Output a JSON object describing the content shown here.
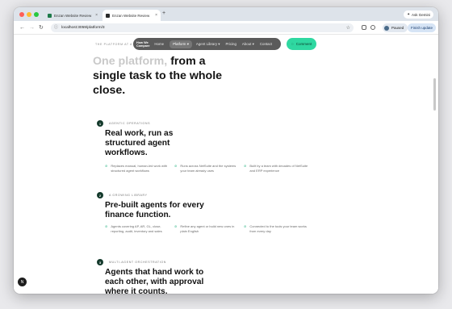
{
  "browser": {
    "tabs": [
      {
        "label": "Enzan Website Review",
        "favicon_color": "#1e7a4a"
      },
      {
        "label": "Enzan Website Review",
        "favicon_color": "#2a2a2a"
      }
    ],
    "new_tab": "+",
    "ask_gemini": "Ask Gemini",
    "url": "localhost:3059/platform/3",
    "profile_label": "Paused",
    "finish_update": "Finish update"
  },
  "site": {
    "eyebrow": "THE PLATFORM AT A GLANCE",
    "logo": "How We Compare",
    "nav": [
      {
        "label": "Home"
      },
      {
        "label": "Platform"
      },
      {
        "label": "Agent Library"
      },
      {
        "label": "Pricing"
      },
      {
        "label": "About"
      },
      {
        "label": "Contact"
      }
    ],
    "cta": "Comment",
    "hero_muted": "One platform,",
    "hero_main": "from a single task to the whole close.",
    "help": "N"
  },
  "steps": [
    {
      "num": "1",
      "tag": "AGENTIC OPERATIONS",
      "title": "Real work, run as structured agent workflows.",
      "bullets": [
        "Replaces manual, human-led work with structured agent workflows",
        "Runs across NetSuite and the systems your team already uses",
        "Built by a team with decades of NetSuite and ERP experience"
      ]
    },
    {
      "num": "2",
      "tag": "A GROWING LIBRARY",
      "title": "Pre-built agents for every finance function.",
      "bullets": [
        "Agents covering AP, AR, GL, close, reporting, audit, inventory and sales",
        "Refine any agent or build new ones in plain English",
        "Connected to the tools your team works from every day"
      ]
    },
    {
      "num": "3",
      "tag": "MULTI-AGENT ORCHESTRATION",
      "title": "Agents that hand work to each other, with approval where it counts.",
      "bullets": []
    }
  ],
  "colors": {
    "accent": "#2fd8a1",
    "step_badge": "#143a2c",
    "nav_pill": "#5b5b5b"
  }
}
